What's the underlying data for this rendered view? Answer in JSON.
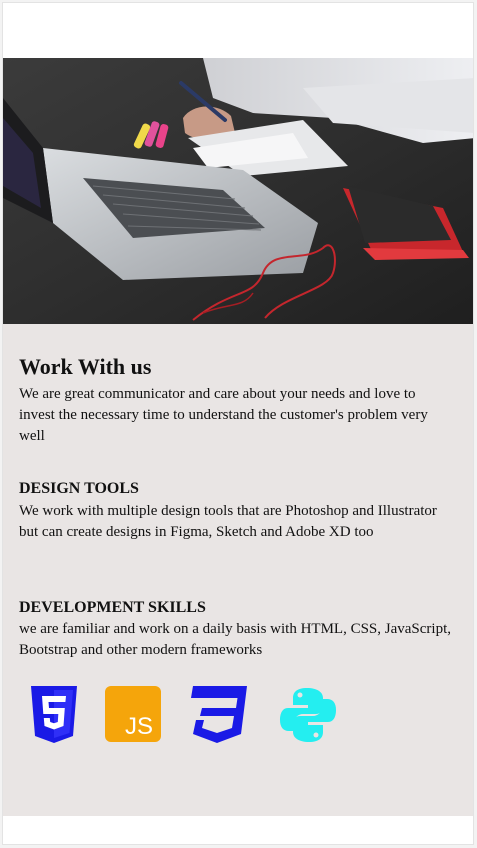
{
  "work": {
    "title": "Work With us",
    "description": "We are great communicator and care about your needs and love to invest the necessary time to understand the customer's problem very well"
  },
  "design": {
    "title": "DESIGN TOOLS",
    "description": "We work with multiple design tools that are Photoshop and Illustrator but can create designs in Figma, Sketch and Adobe XD too"
  },
  "development": {
    "title": "DEVELOPMENT SKILLS",
    "description": "we are familiar and work on a daily basis with HTML, CSS, JavaScript, Bootstrap and other modern frameworks"
  },
  "icons": [
    {
      "name": "html5-icon",
      "color": "#1a1ae6"
    },
    {
      "name": "javascript-icon",
      "color": "#f5a50b",
      "text": "JS"
    },
    {
      "name": "css3-icon",
      "color": "#1a1ae6"
    },
    {
      "name": "python-icon",
      "color": "#24eef0"
    }
  ],
  "colors": {
    "content_background": "#e9e5e4",
    "hero_dark": "#2a2a2a"
  }
}
